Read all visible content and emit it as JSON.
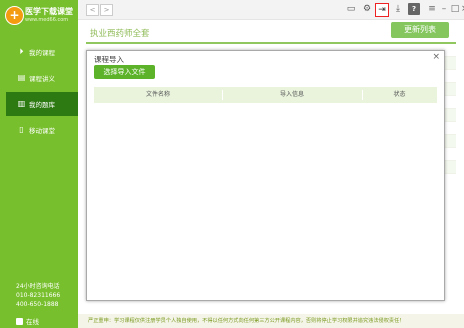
{
  "app": {
    "logo_mark": "+",
    "logo_title": "医学下载课堂",
    "logo_url": "www.med66.com"
  },
  "sidebar": {
    "items": [
      {
        "label": "我的课程",
        "icon": "play-circle-icon"
      },
      {
        "label": "课程讲义",
        "icon": "document-icon"
      },
      {
        "label": "我的题库",
        "icon": "book-icon",
        "active": true
      },
      {
        "label": "移动课堂",
        "icon": "mobile-icon"
      }
    ],
    "hotline_label": "24小时咨询电话",
    "phone1": "010-82311666",
    "phone2": "400-650-1888",
    "status": "在线"
  },
  "toolbar": {
    "back": "<",
    "forward": ">",
    "icons": [
      "chat-icon",
      "gear-icon",
      "import-icon",
      "download-icon",
      "help-icon"
    ],
    "help_glyph": "?",
    "window": [
      "menu-icon",
      "minimize-icon",
      "maximize-icon",
      "close-icon"
    ]
  },
  "main": {
    "course_title": "执业西药师全套",
    "update_button": "更新列表",
    "notice": "严正重申：学习课程仅供注册学员个人独自使用，不得以任何方式向任何第三方公开课程内容，否则将停止学习权限并追究违法侵权责任！"
  },
  "dialog": {
    "title": "课程导入",
    "close_glyph": "×",
    "select_button": "选择导入文件",
    "columns": [
      "文件名称",
      "导入信息",
      "状态"
    ]
  },
  "colors": {
    "accent_green": "#77bf2c",
    "active_nav": "#2d7a12",
    "button_green": "#5cb32a"
  }
}
